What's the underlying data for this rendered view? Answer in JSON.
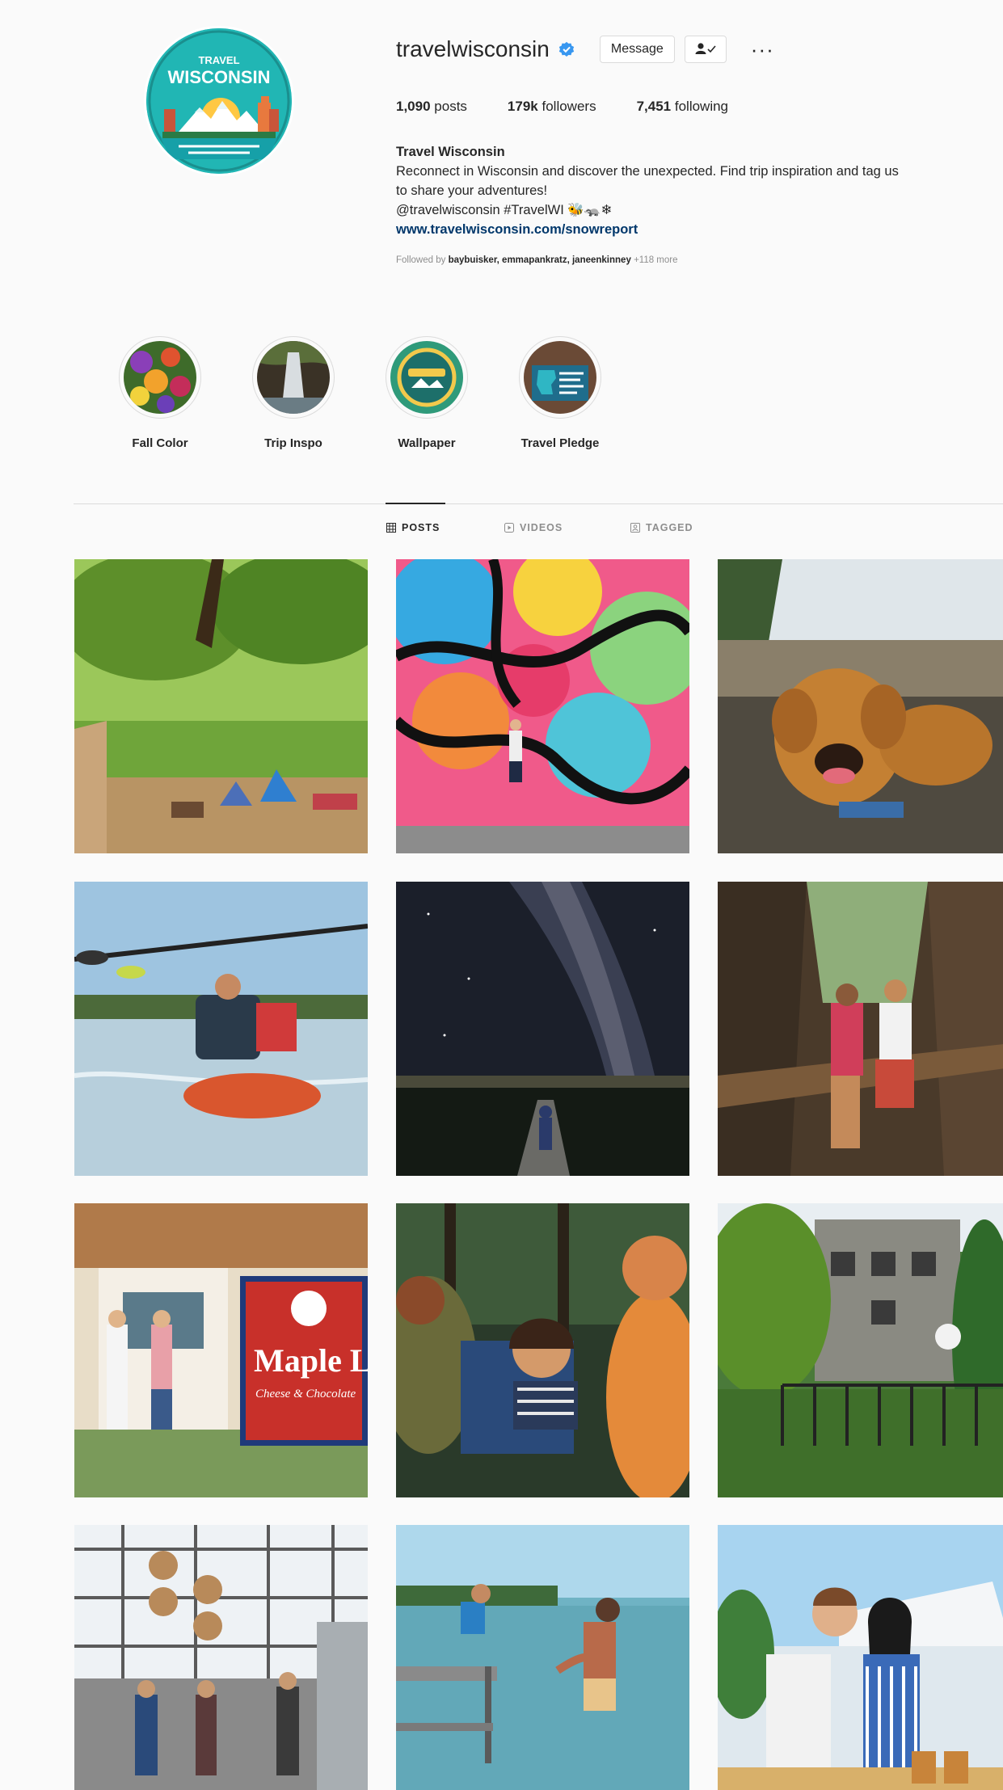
{
  "profile": {
    "username": "travelwisconsin",
    "avatar_text_top": "TRAVEL",
    "avatar_text_main": "WISCONSIN",
    "message_label": "Message",
    "more_label": "···"
  },
  "stats": {
    "posts_count": "1,090",
    "posts_label": "posts",
    "followers_count": "179k",
    "followers_label": "followers",
    "following_count": "7,451",
    "following_label": "following"
  },
  "bio": {
    "name": "Travel Wisconsin",
    "line1": "Reconnect in Wisconsin and discover the unexpected. Find trip inspiration and tag us",
    "line2": "to share your adventures!",
    "line3": "@travelwisconsin #TravelWI 🐝🦡❄",
    "link": "www.travelwisconsin.com/snowreport",
    "followed_prefix": "Followed by",
    "followed_names": "baybuisker, emmapankratz, janeenkinney",
    "followed_more": "+118 more"
  },
  "highlights": [
    {
      "label": "Fall Color",
      "icon": "flowers"
    },
    {
      "label": "Trip Inspo",
      "icon": "waterfall"
    },
    {
      "label": "Wallpaper",
      "icon": "wisconsin-badge"
    },
    {
      "label": "Travel Pledge",
      "icon": "pledge-map"
    }
  ],
  "tabs": [
    {
      "label": "POSTS",
      "icon": "grid-icon",
      "active": true
    },
    {
      "label": "VIDEOS",
      "icon": "video-icon",
      "active": false
    },
    {
      "label": "TAGGED",
      "icon": "tag-icon",
      "active": false
    }
  ],
  "posts": [
    {
      "subject": "campsite-forest"
    },
    {
      "subject": "colorful-mural"
    },
    {
      "subject": "dog-waterfall"
    },
    {
      "subject": "kayakers"
    },
    {
      "subject": "milky-way"
    },
    {
      "subject": "canyon-walk"
    },
    {
      "subject": "maple-leaf-shop",
      "sign_text": "Maple Le",
      "sign_sub": "Cheese & Chocolate"
    },
    {
      "subject": "campfire-family"
    },
    {
      "subject": "inn-garden"
    },
    {
      "subject": "brewery-tour"
    },
    {
      "subject": "lake-dock"
    },
    {
      "subject": "market-couple"
    }
  ],
  "colors": {
    "accent_link": "#00376b",
    "verified": "#3897f0",
    "avatar_teal": "#1fb9b8"
  }
}
